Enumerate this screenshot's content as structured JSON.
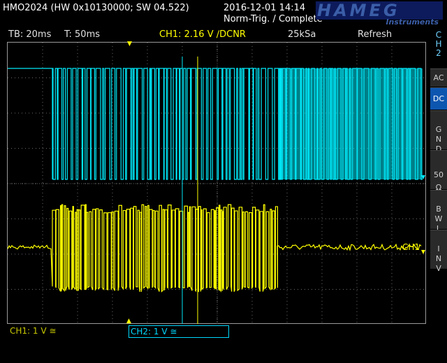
{
  "header": {
    "model": "HMO2024 (HW 0x10130000; SW 04.522)",
    "datetime": "2016-12-01 14:14",
    "trigger_state": "Norm-Trig. / Complete",
    "logo": "HAMEG",
    "logo_sub": "Instruments"
  },
  "infobar": {
    "timebase": "TB: 20ms",
    "trigger_time": "T: 50ms",
    "ch1_trigger": "CH1: 2.16 V ∕DCNR",
    "sample_rate": "25kSa",
    "mode": "Refresh"
  },
  "sidebar": {
    "channel_label": "C\nH\n2",
    "buttons": [
      {
        "label": "AC",
        "selected": false
      },
      {
        "label": "DC",
        "selected": true
      },
      {
        "label": "G\nN\nD",
        "selected": false
      },
      {
        "label": "50\nΩ",
        "selected": false
      },
      {
        "label": "B\nW\nL",
        "selected": false
      },
      {
        "label": "I\nN\nV",
        "selected": false
      }
    ]
  },
  "bottom": {
    "ch1_scale": "CH1: 1 V ≅",
    "ch2_scale": "CH2: 1 V ≅"
  },
  "traces": {
    "ch1_label": "CH1",
    "ch1_marker": "1",
    "ch2_marker": "2"
  },
  "colors": {
    "ch1": "#ffff00",
    "ch2": "#00e8f8",
    "grid": "#6a6a6a",
    "accent": "#0d56b0"
  }
}
